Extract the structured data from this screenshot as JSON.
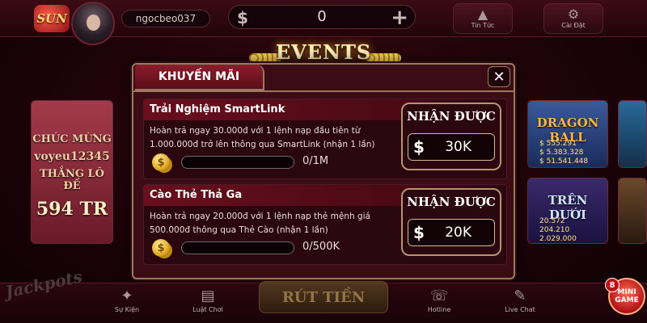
{
  "header": {
    "logo_text": "SUN",
    "username": "ngocbeo037",
    "currency_symbol": "$",
    "balance": "0",
    "add_symbol": "+",
    "news_label": "Tin Tức",
    "settings_label": "Cài Đặt"
  },
  "background_tiles": {
    "lotto": {
      "line1": "CHÚC MỪNG",
      "line2": "voyeu12345",
      "line3": "THẮNG LÔ ĐỀ",
      "line4": "594 TR"
    },
    "dragon_ball": {
      "title": "DRAGON BALL",
      "stats": [
        "$ 555.291",
        "$ 5.383.328",
        "$ 51.541.448"
      ]
    },
    "tren_duoi": {
      "title": "TRÊN DƯỚI",
      "stats": [
        "20.572",
        "204.210",
        "2.029.000"
      ]
    }
  },
  "events_banner": "EVENTS",
  "popup": {
    "tab_label": "KHUYẾN MÃI",
    "close_symbol": "✕",
    "promotions": [
      {
        "title": "Trải Nghiệm SmartLink",
        "description": "Hoàn trả ngay 30.000đ với 1 lệnh nạp đầu tiên từ 1.000.000đ trở lên thông qua SmartLink (nhận 1 lần)",
        "coin_symbol": "$",
        "progress_text": "0/1M",
        "progress_fraction": 0,
        "reward_label": "NHẬN ĐƯỢC",
        "reward_currency": "$",
        "reward_value": "30K"
      },
      {
        "title": "Cào Thẻ Thả Ga",
        "description": "Hoàn trả ngay 20.000đ với 1 lệnh nạp thẻ mệnh giá 500.000đ thông qua Thẻ Cào (nhận 1 lần)",
        "coin_symbol": "$",
        "progress_text": "0/500K",
        "progress_fraction": 0,
        "reward_label": "NHẬN ĐƯỢC",
        "reward_currency": "$",
        "reward_value": "20K"
      }
    ]
  },
  "bottom_nav": {
    "jackpots_label": "Jackpots",
    "events": "Sự Kiện",
    "rules": "Luật Chơi",
    "withdraw": "RÚT TIỀN",
    "hotline": "Hotline",
    "live_chat": "Live Chat",
    "minigame_badge": "8",
    "minigame_label": "MINI GAME"
  },
  "colors": {
    "background": "#1b0308",
    "popup_border": "#9a7a5a",
    "tab_red": "#8a1e2c",
    "progress_fill": "#3fa83a"
  }
}
